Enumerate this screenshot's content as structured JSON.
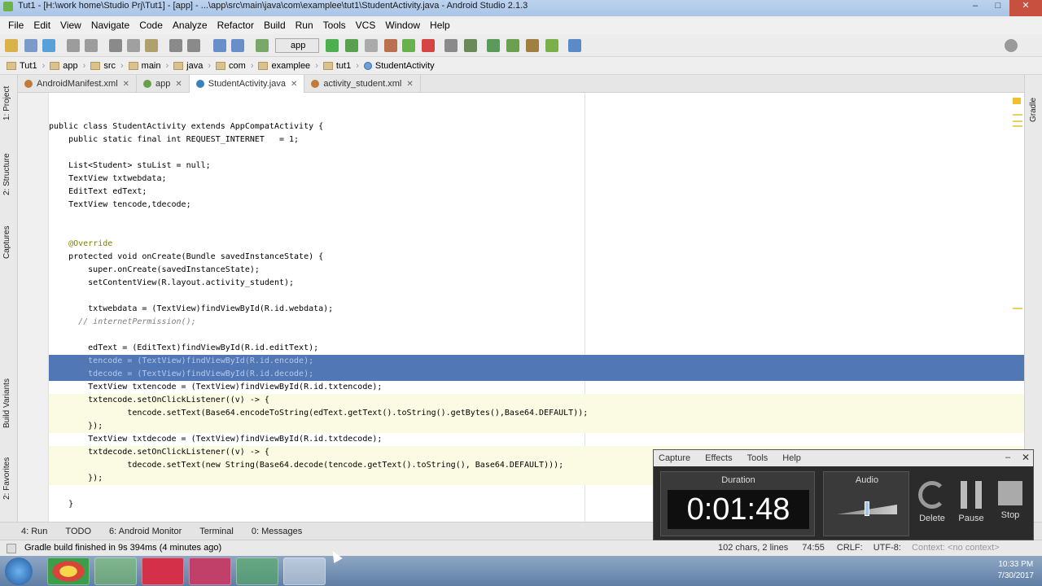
{
  "window": {
    "title": "Tut1 - [H:\\work home\\Studio Prj\\Tut1] - [app] - ...\\app\\src\\main\\java\\com\\examplee\\tut1\\StudentActivity.java - Android Studio 2.1.3"
  },
  "menu": [
    "File",
    "Edit",
    "View",
    "Navigate",
    "Code",
    "Analyze",
    "Refactor",
    "Build",
    "Run",
    "Tools",
    "VCS",
    "Window",
    "Help"
  ],
  "toolbar": {
    "run_config": "app"
  },
  "breadcrumbs": [
    "Tut1",
    "app",
    "src",
    "main",
    "java",
    "com",
    "examplee",
    "tut1",
    "StudentActivity"
  ],
  "tabs": [
    {
      "label": "AndroidManifest.xml",
      "color": "#c07b3a"
    },
    {
      "label": "app",
      "color": "#6a9f4a"
    },
    {
      "label": "StudentActivity.java",
      "color": "#3a7fc0"
    },
    {
      "label": "activity_student.xml",
      "color": "#c07b3a"
    }
  ],
  "side_tools": {
    "left": [
      "1: Project",
      "2: Structure",
      "Captures",
      "Build Variants",
      "2: Favorites"
    ],
    "right": [
      "Gradle"
    ]
  },
  "code": [
    {
      "text": "public class StudentActivity extends AppCompatActivity {",
      "style": ""
    },
    {
      "text": "    public static final int REQUEST_INTERNET   = 1;",
      "style": ""
    },
    {
      "text": "",
      "style": ""
    },
    {
      "text": "    List<Student> stuList = null;",
      "style": ""
    },
    {
      "text": "    TextView txtwebdata;",
      "style": ""
    },
    {
      "text": "    EditText edText;",
      "style": ""
    },
    {
      "text": "    TextView tencode,tdecode;",
      "style": ""
    },
    {
      "text": "",
      "style": ""
    },
    {
      "text": "",
      "style": ""
    },
    {
      "text": "    @Override",
      "style": "ann"
    },
    {
      "text": "    protected void onCreate(Bundle savedInstanceState) {",
      "style": ""
    },
    {
      "text": "        super.onCreate(savedInstanceState);",
      "style": ""
    },
    {
      "text": "        setContentView(R.layout.activity_student);",
      "style": ""
    },
    {
      "text": "",
      "style": ""
    },
    {
      "text": "        txtwebdata = (TextView)findViewById(R.id.webdata);",
      "style": ""
    },
    {
      "text": "      // internetPermission();",
      "style": "cmt"
    },
    {
      "text": "",
      "style": ""
    },
    {
      "text": "        edText = (EditText)findViewById(R.id.editText);",
      "style": ""
    },
    {
      "text": "        tencode = (TextView)findViewById(R.id.encode);",
      "style": "sel"
    },
    {
      "text": "        tdecode = (TextView)findViewById(R.id.decode);",
      "style": "sel"
    },
    {
      "text": "        TextView txtencode = (TextView)findViewById(R.id.txtencode);",
      "style": ""
    },
    {
      "text": "        txtencode.setOnClickListener((v) -> {",
      "style": "hl"
    },
    {
      "text": "                tencode.setText(Base64.encodeToString(edText.getText().toString().getBytes(),Base64.DEFAULT));",
      "style": "hl"
    },
    {
      "text": "        });",
      "style": "hl"
    },
    {
      "text": "        TextView txtdecode = (TextView)findViewById(R.id.txtdecode);",
      "style": ""
    },
    {
      "text": "        txtdecode.setOnClickListener((v) -> {",
      "style": "hl"
    },
    {
      "text": "                tdecode.setText(new String(Base64.decode(tencode.getText().toString(), Base64.DEFAULT)));",
      "style": "hl"
    },
    {
      "text": "        });",
      "style": "hl"
    },
    {
      "text": "",
      "style": ""
    },
    {
      "text": "    }",
      "style": ""
    }
  ],
  "tool_windows": [
    "4: Run",
    "TODO",
    "6: Android Monitor",
    "Terminal",
    "0: Messages"
  ],
  "status": {
    "message": "Gradle build finished in 9s 394ms (4 minutes ago)",
    "chars": "102 chars, 2 lines",
    "position": "74:55",
    "line_sep": "CRLF:",
    "encoding": "UTF-8:",
    "context": "Context: <no context>"
  },
  "recorder": {
    "menu": [
      "Capture",
      "Effects",
      "Tools",
      "Help"
    ],
    "duration_label": "Duration",
    "duration": "0:01:48",
    "audio_label": "Audio",
    "audio_level": 0.5,
    "buttons": [
      "Delete",
      "Pause",
      "Stop"
    ]
  },
  "clock": {
    "time": "10:33 PM",
    "date": "7/30/2017"
  },
  "colors": {
    "selection": "#5277b5",
    "lambda_bg": "#fbfbe3",
    "accent_run": "#4caf50"
  }
}
